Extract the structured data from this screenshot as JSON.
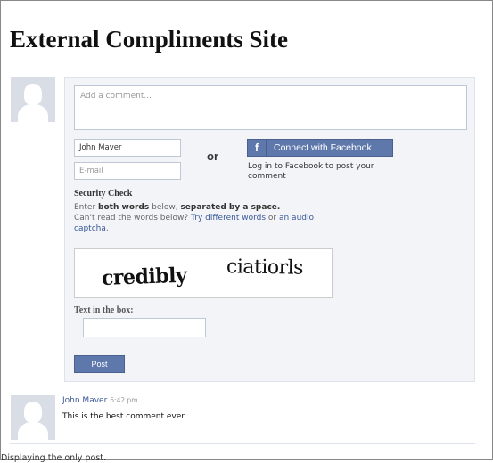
{
  "page": {
    "title": "External Compliments Site"
  },
  "composer": {
    "comment_placeholder": "Add a comment...",
    "name_value": "John Maver",
    "email_placeholder": "E-mail",
    "or_text": "or",
    "facebook_button_icon": "f",
    "facebook_button_label": "Connect with Facebook",
    "facebook_note": "Log in to Facebook to post your comment"
  },
  "security": {
    "heading": "Security Check",
    "line1_pre": "Enter ",
    "line1_bold1": "both words",
    "line1_mid": " below, ",
    "line1_bold2": "separated by a space.",
    "line2_pre": "Can't read the words below? ",
    "line2_link1": "Try different words",
    "line2_mid": " or ",
    "line2_link2": "an audio captcha",
    "line2_end": ".",
    "captcha_word1": "credibly",
    "captcha_word2": "ciatiorls",
    "text_box_label": "Text in the box:",
    "post_label": "Post"
  },
  "comment": {
    "author": "John Maver",
    "time": "6:42 pm",
    "body": "This is the best comment ever"
  },
  "footer": {
    "status": "Displaying the only post."
  },
  "colors": {
    "facebook_blue": "#5f78ab",
    "link_blue": "#3b5998",
    "panel_bg": "#f2f4f8"
  }
}
